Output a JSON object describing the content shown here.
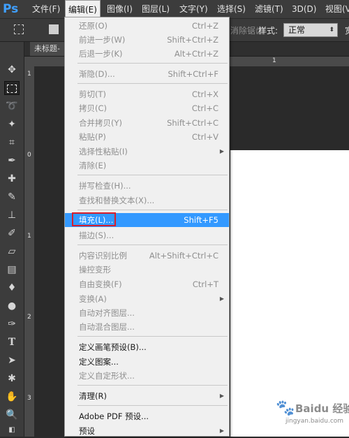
{
  "app": {
    "logo": "Ps"
  },
  "menubar": {
    "items": [
      "文件(F)",
      "编辑(E)",
      "图像(I)",
      "图层(L)",
      "文字(Y)",
      "选择(S)",
      "滤镜(T)",
      "3D(D)",
      "视图(V"
    ],
    "active": "编辑(E)"
  },
  "options_bar": {
    "feather_ghost": "消除锯齿",
    "style_label": "样式:",
    "style_value": "正常",
    "width_label": "宽"
  },
  "document": {
    "tab_label": "未标题-",
    "ruler_top_numbers": [
      "1"
    ],
    "ruler_left_numbers": [
      "1",
      "0",
      "1",
      "2",
      "3"
    ]
  },
  "edit_menu": {
    "items": [
      {
        "label": "还原(O)",
        "shortcut": "Ctrl+Z",
        "state": "disabled"
      },
      {
        "label": "前进一步(W)",
        "shortcut": "Shift+Ctrl+Z",
        "state": "disabled"
      },
      {
        "label": "后退一步(K)",
        "shortcut": "Alt+Ctrl+Z",
        "state": "disabled"
      },
      {
        "label": "渐隐(D)...",
        "shortcut": "Shift+Ctrl+F",
        "state": "disabled"
      },
      {
        "label": "剪切(T)",
        "shortcut": "Ctrl+X",
        "state": "disabled"
      },
      {
        "label": "拷贝(C)",
        "shortcut": "Ctrl+C",
        "state": "disabled"
      },
      {
        "label": "合并拷贝(Y)",
        "shortcut": "Shift+Ctrl+C",
        "state": "disabled"
      },
      {
        "label": "粘贴(P)",
        "shortcut": "Ctrl+V",
        "state": "disabled"
      },
      {
        "label": "选择性粘贴(I)",
        "shortcut": "",
        "state": "disabled",
        "submenu": true
      },
      {
        "label": "清除(E)",
        "shortcut": "",
        "state": "disabled"
      },
      {
        "label": "拼写检查(H)...",
        "shortcut": "",
        "state": "disabled"
      },
      {
        "label": "查找和替换文本(X)...",
        "shortcut": "",
        "state": "disabled"
      },
      {
        "label": "填充(L)...",
        "shortcut": "Shift+F5",
        "state": "highlighted"
      },
      {
        "label": "描边(S)...",
        "shortcut": "",
        "state": "disabled"
      },
      {
        "label": "内容识别比例",
        "shortcut": "Alt+Shift+Ctrl+C",
        "state": "disabled"
      },
      {
        "label": "操控变形",
        "shortcut": "",
        "state": "disabled"
      },
      {
        "label": "自由变换(F)",
        "shortcut": "Ctrl+T",
        "state": "disabled"
      },
      {
        "label": "变换(A)",
        "shortcut": "",
        "state": "disabled",
        "submenu": true
      },
      {
        "label": "自动对齐图层...",
        "shortcut": "",
        "state": "disabled"
      },
      {
        "label": "自动混合图层...",
        "shortcut": "",
        "state": "disabled"
      },
      {
        "label": "定义画笔预设(B)...",
        "shortcut": "",
        "state": "enabled"
      },
      {
        "label": "定义图案...",
        "shortcut": "",
        "state": "enabled"
      },
      {
        "label": "定义自定形状...",
        "shortcut": "",
        "state": "disabled"
      },
      {
        "label": "清理(R)",
        "shortcut": "",
        "state": "enabled",
        "submenu": true
      },
      {
        "label": "Adobe PDF 预设...",
        "shortcut": "",
        "state": "enabled"
      },
      {
        "label": "预设",
        "shortcut": "",
        "state": "enabled",
        "submenu": true
      }
    ]
  },
  "colors": {
    "highlight": "#3399ff",
    "annotation_box": "#d81e2b",
    "ps_logo": "#3fa0ff"
  },
  "watermark": {
    "brand": "Baidu 经验",
    "url": "jingyan.baidu.com"
  }
}
